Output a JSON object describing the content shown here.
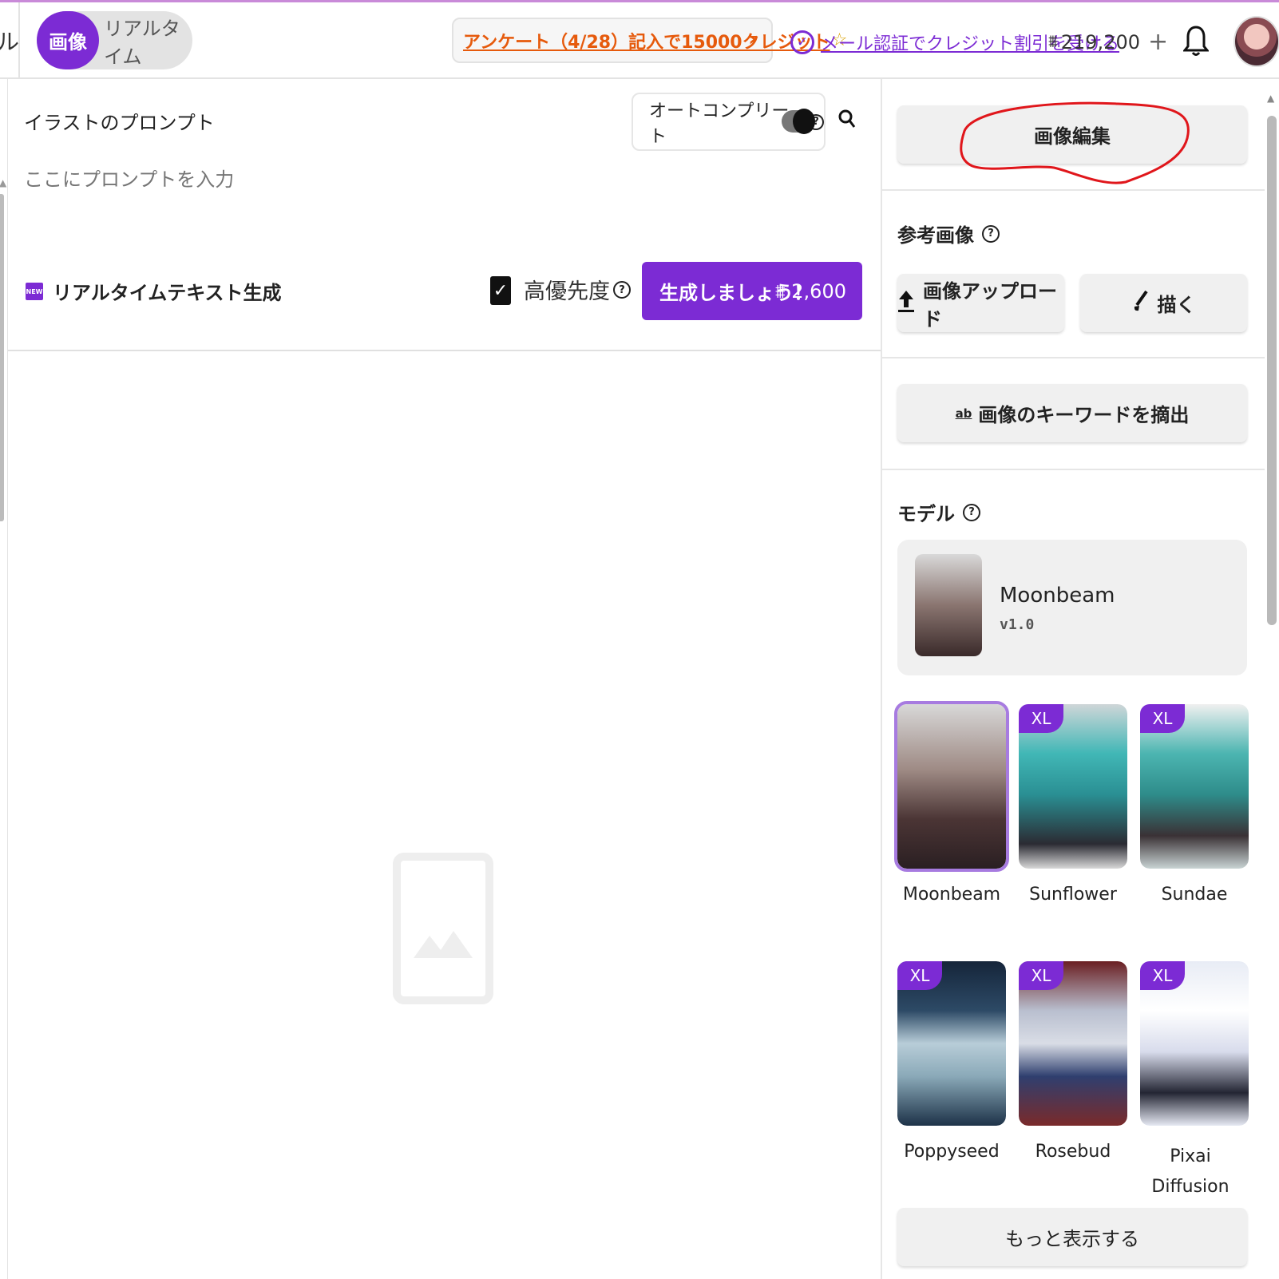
{
  "topbar": {
    "edge_char": "ル",
    "mode_image": "画像",
    "mode_realtime": "リアルタイム",
    "survey_text": "アンケート（4/28）記入で15000クレジット",
    "verify_text": "メール認証でクレジット割引を受ける",
    "credits": "219,200",
    "plus": "+"
  },
  "prompt": {
    "label": "イラストのプロンプト",
    "autocomplete_label": "オートコンプリート",
    "autocomplete_on": true,
    "placeholder": "ここにプロンプトを入力",
    "new_badge": "NEW",
    "realtime_text_gen": "リアルタイムテキスト生成",
    "priority_label": "高優先度",
    "priority_checked": true,
    "generate_label": "生成しましょう！",
    "generate_cost": "2,600"
  },
  "right": {
    "edit_button": "画像編集",
    "reference_label": "参考画像",
    "upload_button": "画像アップロード",
    "draw_button": "描く",
    "keyword_button": "画像のキーワードを摘出",
    "model_label": "モデル",
    "selected_model": {
      "name": "Moonbeam",
      "version": "v1.0"
    },
    "models": [
      {
        "name": "Moonbeam",
        "xl": false,
        "selected": true
      },
      {
        "name": "Sunflower",
        "xl": true
      },
      {
        "name": "Sundae",
        "xl": true
      },
      {
        "name": "Poppyseed",
        "xl": true
      },
      {
        "name": "Rosebud",
        "xl": true
      },
      {
        "name": "Pixai Diffusion (CG)",
        "xl": true
      }
    ],
    "xl_badge": "XL",
    "more_button": "もっと表示する"
  },
  "colors": {
    "accent": "#7c2bd4",
    "survey": "#e65a0c",
    "annotation": "#e0161b"
  }
}
